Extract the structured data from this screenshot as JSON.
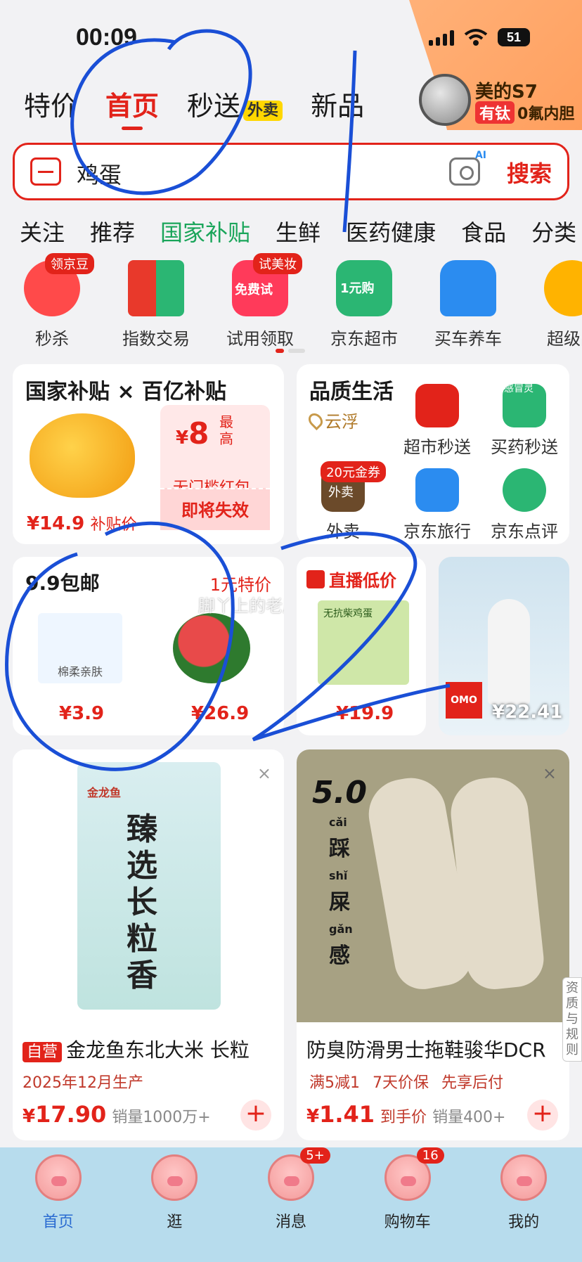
{
  "status_bar": {
    "time": "00:09",
    "battery": "51"
  },
  "promo": {
    "title": "美的S7",
    "tag_red": "有钛",
    "tag_text": "0氟内胆"
  },
  "top_tabs": [
    {
      "label": "特价"
    },
    {
      "label": "首页",
      "active": true
    },
    {
      "label": "秒送",
      "badge": "外卖"
    },
    {
      "label": "新品"
    }
  ],
  "search": {
    "query": "鸡蛋",
    "button": "搜索",
    "camera_badge": "AI"
  },
  "category_tabs": [
    "关注",
    "推荐",
    "国家补贴",
    "生鲜",
    "医药健康",
    "食品",
    "分类"
  ],
  "quick_icons": [
    {
      "label": "秒杀",
      "tag": "领京豆",
      "color": "#ff4a4a"
    },
    {
      "label": "指数交易",
      "tag": "",
      "color": "#e8392b"
    },
    {
      "label": "试用领取",
      "tag": "试美妆",
      "inner": "免费试",
      "color": "#ff3a5a"
    },
    {
      "label": "京东超市",
      "tag": "",
      "inner": "1元购",
      "color": "#2bb673"
    },
    {
      "label": "买车养车",
      "tag": "",
      "color": "#2b8cf0"
    },
    {
      "label": "超级品",
      "tag": "",
      "color": "#ffb300"
    }
  ],
  "subsidy_card": {
    "title": "国家补贴 × 百亿补贴",
    "coupon_symbol": "¥",
    "coupon_amount": "8",
    "coupon_note": "最高",
    "coupon_desc": "无门槛红包",
    "coupon_btn": "即将失效",
    "price": "¥14.9",
    "price_tag": "补贴价"
  },
  "quality_card": {
    "title": "品质生活",
    "location": "云浮",
    "items": [
      {
        "label": "超市秒送",
        "color": "#e2231a"
      },
      {
        "label": "买药秒送",
        "color": "#2bb673",
        "inner": "感冒灵"
      },
      {
        "label": "外卖",
        "color": "#6b4a2a",
        "tag": "20元金券",
        "inner": "外卖"
      },
      {
        "label": "京东旅行",
        "color": "#2b8cf0"
      },
      {
        "label": "京东点评",
        "color": "#2bb673"
      }
    ]
  },
  "deal_card": {
    "title": "9.9包邮",
    "subtitle": "1元特价",
    "watermark": "脚丫上的老屋鞋",
    "items": [
      {
        "price": "¥3.9",
        "text": "棉柔亲肤"
      },
      {
        "price": "¥26.9"
      }
    ]
  },
  "live_card": {
    "title": "直播低价",
    "price": "¥19.9",
    "box_text": "无抗柴鸡蛋"
  },
  "video_card": {
    "price": "¥22.41",
    "product": "OMO"
  },
  "products": [
    {
      "badge": "自营",
      "name": "金龙鱼东北大米 长粒",
      "sub": "2025年12月生产",
      "price_symbol": "¥",
      "price": "17.90",
      "sales": "销量1000万+",
      "bag_text": "臻选长粒香",
      "brand": "金龙鱼"
    },
    {
      "badge": "",
      "name": "防臭防滑男士拖鞋骏华DCR",
      "promo1": "满5减1",
      "promo2": "7天价保",
      "promo3": "先享后付",
      "price_symbol": "¥",
      "price": "1.41",
      "price_note": "到手价",
      "sales": "销量400+",
      "rating": "5.0",
      "slogan": [
        "踩",
        "屎",
        "感"
      ],
      "pinyin": [
        "cǎi",
        "shǐ",
        "gǎn"
      ]
    }
  ],
  "side_tag": "资质与规则",
  "bottom_nav": [
    {
      "label": "首页",
      "active": true
    },
    {
      "label": "逛"
    },
    {
      "label": "消息",
      "badge": "5+"
    },
    {
      "label": "购物车",
      "badge": "16"
    },
    {
      "label": "我的"
    }
  ],
  "colors": {
    "brand_red": "#e2231a",
    "green": "#1aa55a",
    "nav_bg": "#b7dced",
    "scribble": "#1a4fd6"
  }
}
